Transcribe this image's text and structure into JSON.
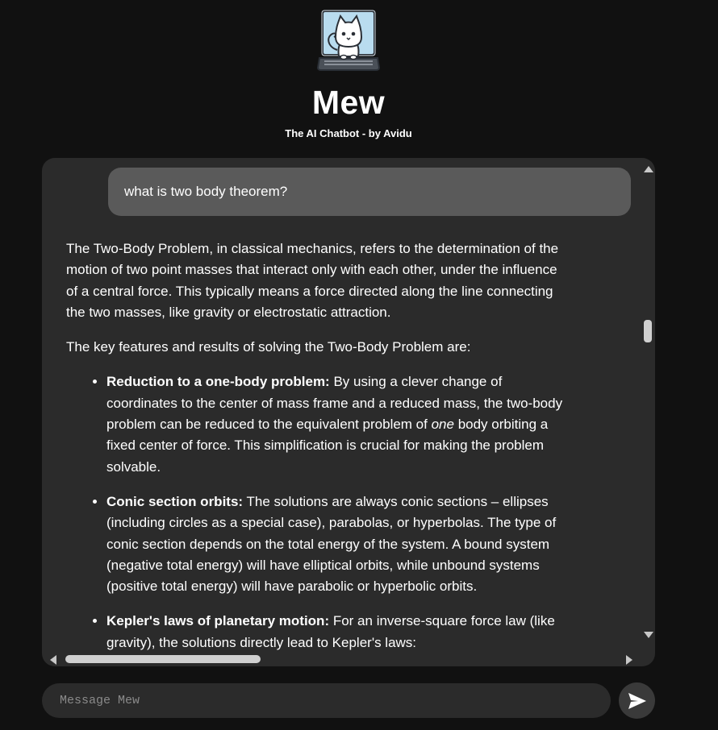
{
  "header": {
    "logo_icon": "cat-at-laptop-icon",
    "title": "Mew",
    "subtitle": "The AI Chatbot - by Avidu"
  },
  "chat": {
    "user_message": "what is two body theorem?",
    "bot_response": {
      "paragraphs": [
        "The Two-Body Problem, in classical mechanics, refers to the determination of the motion of two point masses that interact only with each other, under the influence of a central force. This typically means a force directed along the line connecting the two masses, like gravity or electrostatic attraction.",
        "The key features and results of solving the Two-Body Problem are:"
      ],
      "bullets": [
        {
          "title": "Reduction to a one-body problem:",
          "text_before": " By using a clever change of coordinates to the center of mass frame and a reduced mass, the two-body problem can be reduced to the equivalent problem of ",
          "emphasis": "one",
          "text_after": " body orbiting a fixed center of force. This simplification is crucial for making the problem solvable."
        },
        {
          "title": "Conic section orbits:",
          "text": " The solutions are always conic sections – ellipses (including circles as a special case), parabolas, or hyperbolas. The type of conic section depends on the total energy of the system. A bound system (negative total energy) will have elliptical orbits, while unbound systems (positive total energy) will have parabolic or hyperbolic orbits."
        },
        {
          "title": "Kepler's laws of planetary motion:",
          "text": " For an inverse-square force law (like gravity), the solutions directly lead to Kepler's laws:"
        }
      ]
    }
  },
  "composer": {
    "placeholder": "Message Mew",
    "send_icon": "send-arrow-icon"
  },
  "colors": {
    "page_background": "#111111",
    "panel_background": "#2b2b2b",
    "user_bubble": "#5a5a5a",
    "text": "#ffffff",
    "placeholder": "#8a8a8a"
  }
}
